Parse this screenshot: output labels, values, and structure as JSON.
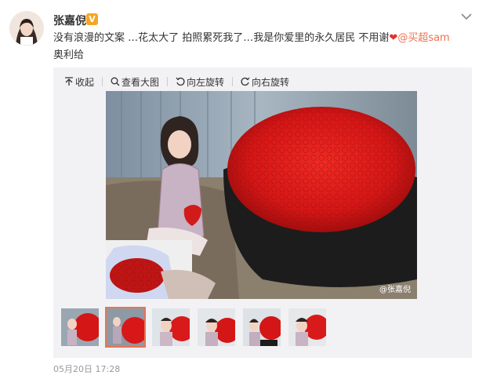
{
  "post": {
    "author": "张嘉倪",
    "verified_badge": "V",
    "text_before": "没有浪漫的文案 …花太大了 拍照累死我了…我是你爱里的永久居民 不用谢",
    "mention": "@买超sam",
    "text_after": " 奥利给",
    "timestamp": "05月20日 17:28"
  },
  "toolbar": {
    "collapse": "收起",
    "view_large": "查看大图",
    "rotate_left": "向左旋转",
    "rotate_right": "向右旋转"
  },
  "image": {
    "watermark": "@张嘉倪"
  },
  "thumbnails": {
    "count": 6,
    "active_index": 1
  },
  "colors": {
    "accent": "#eb7350",
    "heart": "#e5312e",
    "rose_red": "#d91a1a"
  }
}
